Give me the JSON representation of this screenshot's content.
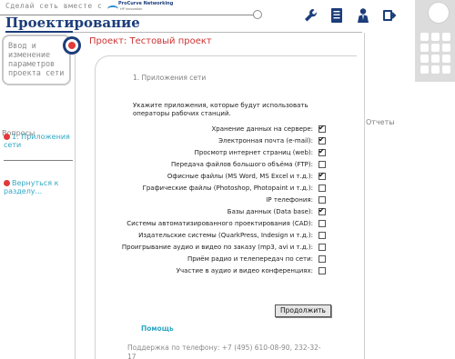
{
  "header": {
    "tagline": "Сделай сеть вместе с",
    "logo": {
      "brand": "ProCurve Networking",
      "sub": "HP Innovation"
    },
    "app_title": "Проектирование",
    "toolbar_icons": [
      "wrench-icon",
      "document-icon",
      "user-icon",
      "exit-icon"
    ]
  },
  "sidebar": {
    "box_lines": [
      "Ввод и",
      "изменение",
      "параметров",
      "проекта сети"
    ],
    "section_title": "Вопросы",
    "items": [
      {
        "label": "1. Приложения сети"
      },
      {
        "label": "Вернуться к разделу..."
      }
    ]
  },
  "project": {
    "title": "Проект: Тестовый проект"
  },
  "form": {
    "step_title": "1. Приложения сети",
    "intro": "Укажите приложения, которые будут использовать операторы рабочих станций.",
    "items": [
      {
        "label": "Хранение данных на сервере:",
        "checked": true
      },
      {
        "label": "Электронная почта (e-mail):",
        "checked": true
      },
      {
        "label": "Просмотр интернет страниц (web):",
        "checked": true
      },
      {
        "label": "Передача файлов большого объёма (FTP):",
        "checked": false
      },
      {
        "label": "Офисные файлы (MS Word, MS Excel и т.д.):",
        "checked": true
      },
      {
        "label": "Графические файлы (Photoshop, Photopaint и т.д.):",
        "checked": false
      },
      {
        "label": "IP телефония:",
        "checked": false
      },
      {
        "label": "Базы данных (Data base):",
        "checked": true
      },
      {
        "label": "Системы автоматизированного проектирования (CAD):",
        "checked": false
      },
      {
        "label": "Издательские системы (QuarkPress, Indesign и т.д.):",
        "checked": false
      },
      {
        "label": "Проигрывание аудио и видео по заказу (mp3, avi и т.д.):",
        "checked": false
      },
      {
        "label": "Приём радио и телепередач по сети:",
        "checked": false
      },
      {
        "label": "Участие в аудио и видео конференциях:",
        "checked": false
      }
    ],
    "continue_label": "Продолжить"
  },
  "footer": {
    "help_label": "Помощь",
    "support": "Поддержка по телефону: +7 (495) 610-08-90, 232-32-17"
  },
  "right": {
    "reports_title": "Отчеты"
  },
  "colors": {
    "title_blue": "#1c3d7a",
    "link_cyan": "#32a8c4",
    "accent_red": "#cc3333",
    "muted_gray": "#7f7f7f"
  }
}
